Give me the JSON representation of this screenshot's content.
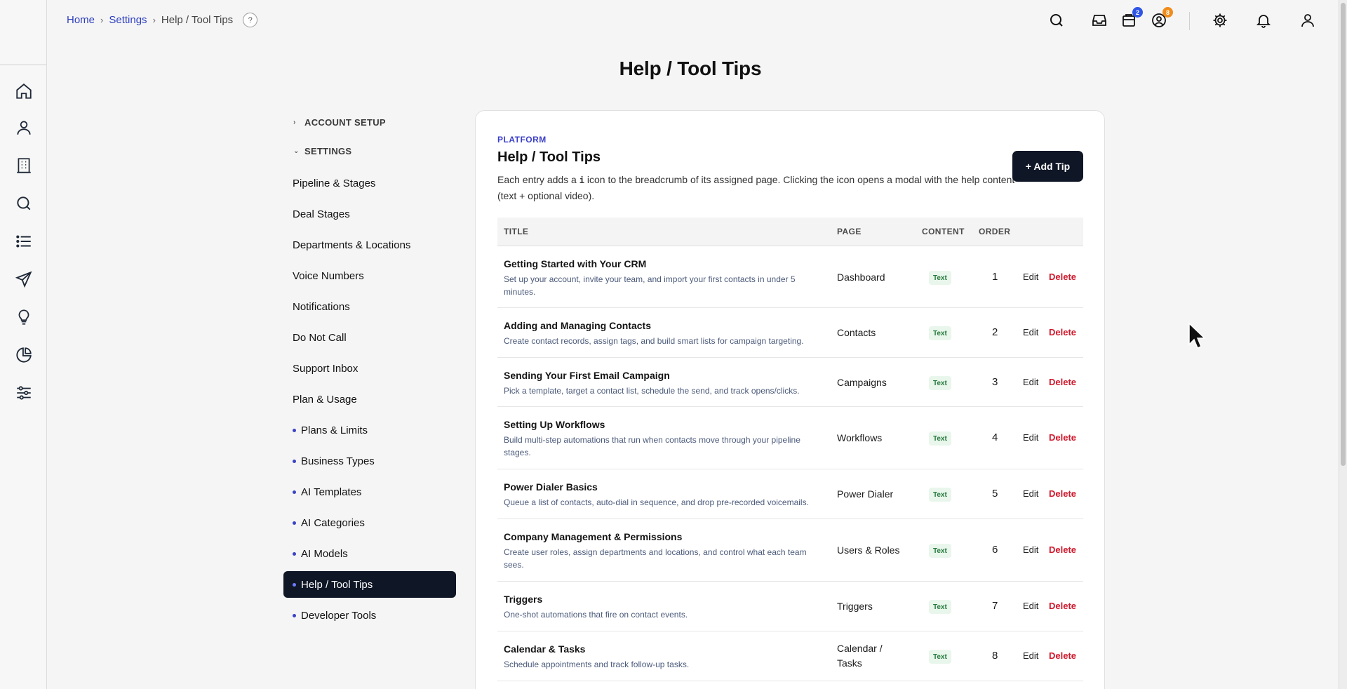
{
  "breadcrumb": {
    "home": "Home",
    "settings": "Settings",
    "current": "Help / Tool Tips",
    "help_glyph": "?"
  },
  "topbar": {
    "icons": [
      "search-icon",
      "inbox-icon",
      "calendar-icon",
      "updates-icon",
      "gear-icon",
      "bell-icon",
      "user-icon"
    ],
    "calendar_badge": "2",
    "updates_badge": "8",
    "badge_colors": {
      "blue": "#2f55e6",
      "orange": "#f08c1c"
    }
  },
  "page_title": "Help / Tool Tips",
  "nav": {
    "groups": {
      "account_setup": "ACCOUNT SETUP",
      "settings": "SETTINGS"
    },
    "items": [
      "Pipeline & Stages",
      "Deal Stages",
      "Departments & Locations",
      "Voice Numbers",
      "Notifications",
      "Do Not Call",
      "Support Inbox",
      "Plan & Usage"
    ],
    "sub_items": [
      "Plans & Limits",
      "Business Types",
      "AI Templates",
      "AI Categories",
      "AI Models",
      "Help / Tool Tips",
      "Developer Tools"
    ]
  },
  "card": {
    "eyebrow": "PLATFORM",
    "title": "Help / Tool Tips",
    "desc_before": "Each entry adds a ",
    "desc_glyph": "i",
    "desc_after": " icon to the breadcrumb of its assigned page. Clicking the icon opens a modal with the help content (text + optional video).",
    "add_button": "+ Add Tip"
  },
  "table": {
    "headers": {
      "title": "TITLE",
      "page": "PAGE",
      "content": "CONTENT",
      "order": "ORDER"
    },
    "actions": {
      "edit": "Edit",
      "delete": "Delete"
    },
    "rows": [
      {
        "title": "Getting Started with Your CRM",
        "desc": "Set up your account, invite your team, and import your first contacts in under 5 minutes.",
        "page": "Dashboard",
        "content": "Text",
        "order": "1"
      },
      {
        "title": "Adding and Managing Contacts",
        "desc": "Create contact records, assign tags, and build smart lists for campaign targeting.",
        "page": "Contacts",
        "content": "Text",
        "order": "2"
      },
      {
        "title": "Sending Your First Email Campaign",
        "desc": "Pick a template, target a contact list, schedule the send, and track opens/clicks.",
        "page": "Campaigns",
        "content": "Text",
        "order": "3"
      },
      {
        "title": "Setting Up Workflows",
        "desc": "Build multi-step automations that run when contacts move through your pipeline stages.",
        "page": "Workflows",
        "content": "Text",
        "order": "4"
      },
      {
        "title": "Power Dialer Basics",
        "desc": "Queue a list of contacts, auto-dial in sequence, and drop pre-recorded voicemails.",
        "page": "Power Dialer",
        "content": "Text",
        "order": "5"
      },
      {
        "title": "Company Management & Permissions",
        "desc": "Create user roles, assign departments and locations, and control what each team sees.",
        "page": "Users & Roles",
        "content": "Text",
        "order": "6"
      },
      {
        "title": "Triggers",
        "desc": "One-shot automations that fire on contact events.",
        "page": "Triggers",
        "content": "Text",
        "order": "7"
      },
      {
        "title": "Calendar & Tasks",
        "desc": "Schedule appointments and track follow-up tasks.",
        "page": "Calendar / Tasks",
        "content": "Text",
        "order": "8"
      }
    ]
  },
  "colors": {
    "accent": "#3b3fc7",
    "dark": "#0f1626",
    "danger": "#d0182c",
    "tag_bg": "#e9f6ec",
    "tag_fg": "#237a3a"
  }
}
